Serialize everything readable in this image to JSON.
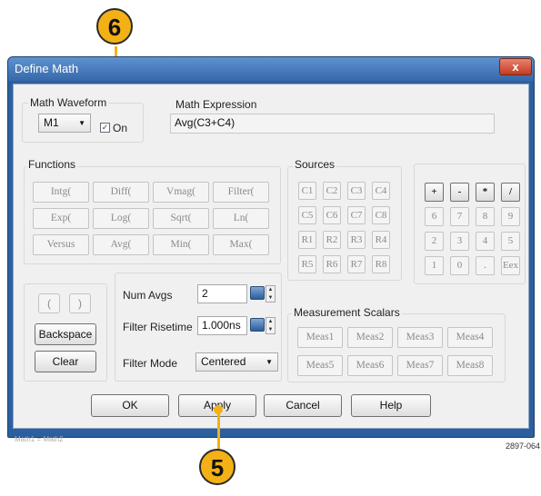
{
  "callouts": {
    "top": "6",
    "bottom": "5"
  },
  "figure_id": "2897-064",
  "background_caption": "Math1 = Math2",
  "dialog": {
    "title": "Define Math",
    "close_label": "x",
    "math_waveform": {
      "label": "Math Waveform",
      "selected": "M1",
      "on_label": "On",
      "on_checked": true
    },
    "math_expression": {
      "label": "Math Expression",
      "value": "Avg(C3+C4)"
    },
    "functions": {
      "label": "Functions",
      "rows": [
        [
          "Intg(",
          "Diff(",
          "Vmag(",
          "Filter("
        ],
        [
          "Exp(",
          "Log(",
          "Sqrt(",
          "Ln("
        ],
        [
          "Versus",
          "Avg(",
          "Min(",
          "Max("
        ]
      ]
    },
    "sources": {
      "label": "Sources",
      "rows": [
        [
          "C1",
          "C2",
          "C3",
          "C4"
        ],
        [
          "C5",
          "C6",
          "C7",
          "C8"
        ],
        [
          "R1",
          "R2",
          "R3",
          "R4"
        ],
        [
          "R5",
          "R6",
          "R7",
          "R8"
        ]
      ]
    },
    "keypad": {
      "rows": [
        [
          "+",
          "-",
          "*",
          "/"
        ],
        [
          "6",
          "7",
          "8",
          "9"
        ],
        [
          "2",
          "3",
          "4",
          "5"
        ],
        [
          "1",
          "0",
          ".",
          "Eex"
        ]
      ]
    },
    "edit": {
      "open_paren": "(",
      "close_paren": ")",
      "backspace": "Backspace",
      "clear": "Clear"
    },
    "averaging": {
      "num_avgs_label": "Num Avgs",
      "num_avgs_value": "2",
      "filter_risetime_label": "Filter Risetime",
      "filter_risetime_value": "1.000ns",
      "filter_mode_label": "Filter Mode",
      "filter_mode_value": "Centered"
    },
    "measurement_scalars": {
      "label": "Measurement Scalars",
      "rows": [
        [
          "Meas1",
          "Meas2",
          "Meas3",
          "Meas4"
        ],
        [
          "Meas5",
          "Meas6",
          "Meas7",
          "Meas8"
        ]
      ]
    },
    "buttons": {
      "ok": "OK",
      "apply": "Apply",
      "cancel": "Cancel",
      "help": "Help"
    }
  }
}
